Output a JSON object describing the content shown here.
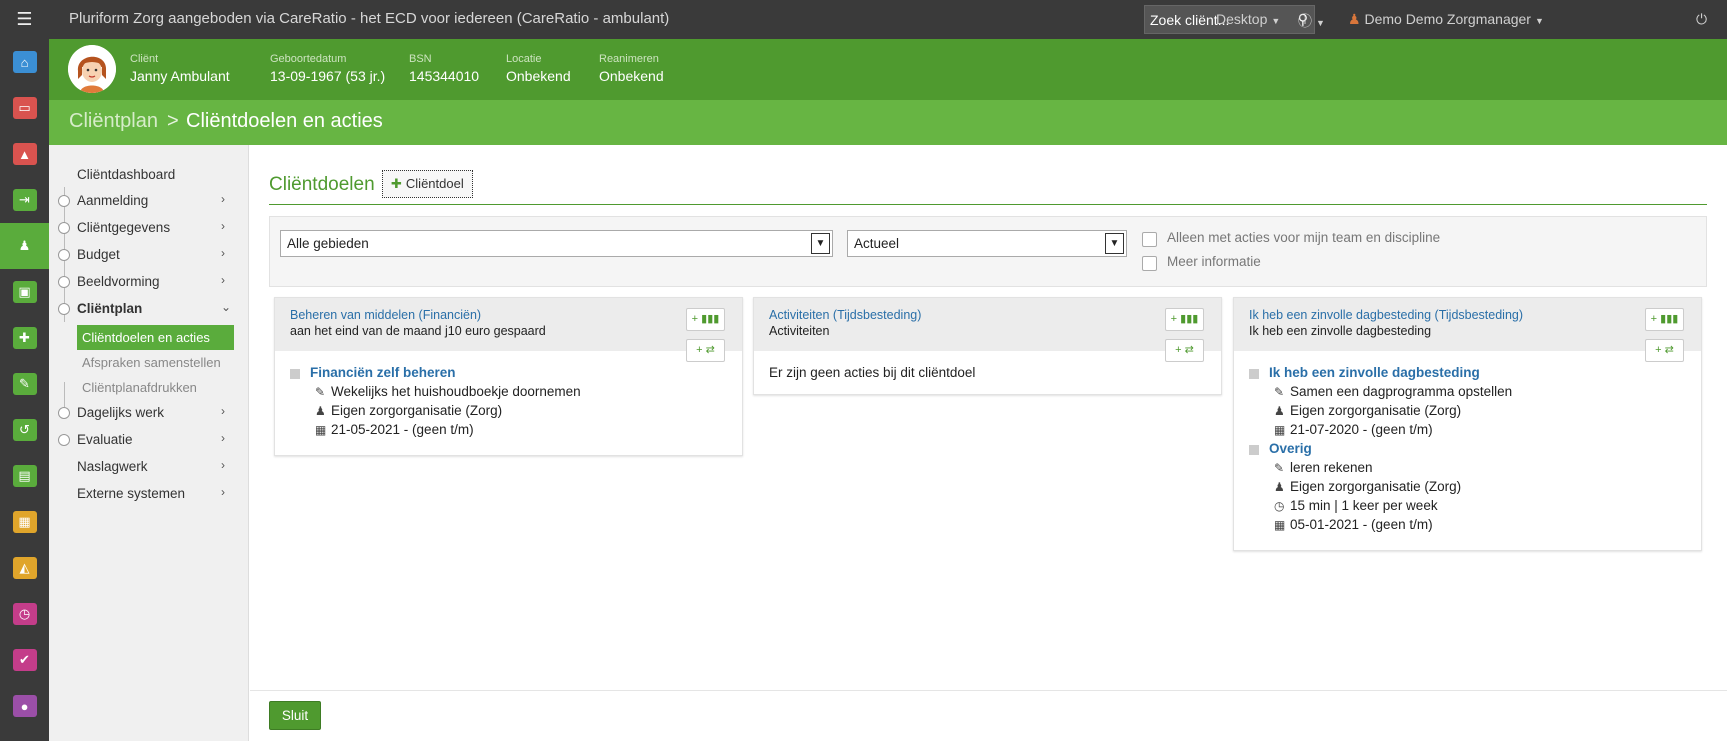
{
  "app": {
    "title": "Pluriform Zorg aangeboden via CareRatio - het ECD voor iedereen  (CareRatio - ambulant)",
    "search_placeholder": "Zoek cliënt...",
    "desktop_label": "Desktop",
    "user_label": "Demo Demo Zorgmanager"
  },
  "rail": {
    "icons": [
      {
        "name": "home-icon",
        "glyph": "⌂",
        "color": "#3b8fd4"
      },
      {
        "name": "inbox-icon",
        "glyph": "▭",
        "color": "#d9534f"
      },
      {
        "name": "warning-icon",
        "glyph": "▲",
        "color": "#d9534f"
      },
      {
        "name": "sign-in-icon",
        "glyph": "⇥",
        "color": "#5aac3c"
      },
      {
        "name": "client-icon",
        "glyph": "♟",
        "color": "#5aac3c"
      },
      {
        "name": "money-icon",
        "glyph": "▣",
        "color": "#5aac3c"
      },
      {
        "name": "puzzle-icon",
        "glyph": "✚",
        "color": "#5aac3c"
      },
      {
        "name": "pencil-icon",
        "glyph": "✎",
        "color": "#5aac3c"
      },
      {
        "name": "undo-icon",
        "glyph": "↺",
        "color": "#5aac3c"
      },
      {
        "name": "document-icon",
        "glyph": "▤",
        "color": "#5aac3c"
      },
      {
        "name": "calendar-icon",
        "glyph": "▦",
        "color": "#e0a52b"
      },
      {
        "name": "road-icon",
        "glyph": "◭",
        "color": "#e0a52b"
      },
      {
        "name": "clock-icon",
        "glyph": "◷",
        "color": "#c43d8a"
      },
      {
        "name": "check-icon",
        "glyph": "✔",
        "color": "#c43d8a"
      },
      {
        "name": "user-icon",
        "glyph": "●",
        "color": "#9b4fa8"
      }
    ]
  },
  "client": {
    "fields": [
      {
        "label": "Cliënt",
        "value": "Janny Ambulant"
      },
      {
        "label": "Geboortedatum",
        "value": "13-09-1967 (53 jr.)"
      },
      {
        "label": "BSN",
        "value": "145344010"
      },
      {
        "label": "Locatie",
        "value": "Onbekend"
      },
      {
        "label": "Reanimeren",
        "value": "Onbekend"
      }
    ]
  },
  "breadcrumb": {
    "parent": "Cliëntplan",
    "separator": ">",
    "current": "Cliëntdoelen en acties"
  },
  "nav": {
    "items": [
      {
        "label": "Cliëntdashboard"
      },
      {
        "label": "Aanmelding"
      },
      {
        "label": "Cliëntgegevens"
      },
      {
        "label": "Budget"
      },
      {
        "label": "Beeldvorming"
      },
      {
        "label": "Cliëntplan"
      },
      {
        "label": "Dagelijks werk"
      },
      {
        "label": "Evaluatie"
      },
      {
        "label": "Naslagwerk"
      },
      {
        "label": "Externe systemen"
      }
    ],
    "sub": [
      {
        "label": "Cliëntdoelen en acties"
      },
      {
        "label": "Afspraken samenstellen"
      },
      {
        "label": "Cliëntplanafdrukken"
      }
    ]
  },
  "main": {
    "section_title": "Cliëntdoelen",
    "add_button": "Cliëntdoel",
    "filters": {
      "gebied": "Alle gebieden",
      "status": "Actueel",
      "check1": "Alleen met acties voor mijn team en discipline",
      "check2": "Meer informatie"
    },
    "cards": [
      {
        "title": "Beheren van middelen (Financiën)",
        "subtitle": "aan het eind van de maand j10 euro gespaard",
        "actions": [
          {
            "name": "Financiën zelf beheren",
            "task": "Wekelijks het huishoudboekje doornemen",
            "org": "Eigen zorgorganisatie (Zorg)",
            "date": "21-05-2021 - (geen t/m)"
          }
        ]
      },
      {
        "title": "Activiteiten (Tijdsbesteding)",
        "subtitle": "Activiteiten",
        "empty": "Er zijn geen acties bij dit cliëntdoel"
      },
      {
        "title": "Ik heb een zinvolle dagbesteding (Tijdsbesteding)",
        "subtitle": "Ik heb een zinvolle dagbesteding",
        "actions": [
          {
            "name": "Ik heb een zinvolle dagbesteding",
            "task": "Samen een dagprogramma opstellen",
            "org": "Eigen zorgorganisatie (Zorg)",
            "date": "21-07-2020 - (geen t/m)"
          },
          {
            "name": "Overig",
            "task": "leren rekenen",
            "org": "Eigen zorgorganisatie (Zorg)",
            "freq": "15 min | 1 keer per week",
            "date": "05-01-2021 - (geen t/m)"
          }
        ]
      }
    ],
    "mini_btn_chart": "+ ▮▮▮",
    "mini_btn_shuffle": "+ ⇄"
  },
  "footer": {
    "close_label": "Sluit"
  }
}
